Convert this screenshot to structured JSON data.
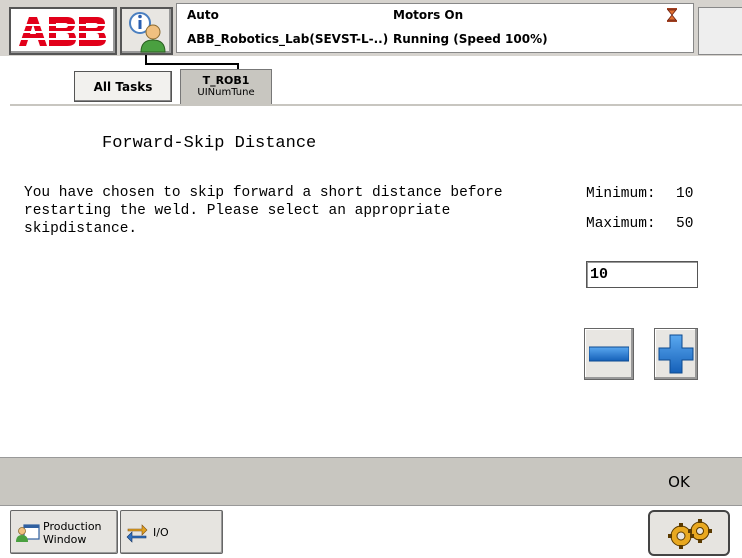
{
  "status": {
    "mode": "Auto",
    "system_name": "ABB_Robotics_Lab(SEVST-L-..)",
    "motors": "Motors On",
    "running": "Running (Speed 100%)"
  },
  "tasks": {
    "all_tasks_label": "All Tasks",
    "active_task": "T_ROB1",
    "active_module": "UINumTune"
  },
  "dialog": {
    "title": "Forward-Skip Distance",
    "description": "You have chosen to skip forward a short distance before restarting the weld. Please select an appropriate skipdistance.",
    "min_label": "Minimum:",
    "min_value": "10",
    "max_label": "Maximum:",
    "max_value": "50",
    "input_value": "10"
  },
  "commands": {
    "ok_label": "OK"
  },
  "taskbar": {
    "production_label_line1": "Production",
    "production_label_line2": "Window",
    "io_label": "I/O"
  },
  "colors": {
    "brand_red": "#e2001a",
    "step_blue": "#1f78d1"
  },
  "icons": {
    "logo": "abb-logo",
    "info": "user-info-icon",
    "hourglass": "hourglass-icon",
    "minus": "minus-icon",
    "plus": "plus-icon",
    "production": "production-window-icon",
    "io": "io-arrows-icon",
    "quickset": "quickset-gears-icon"
  }
}
